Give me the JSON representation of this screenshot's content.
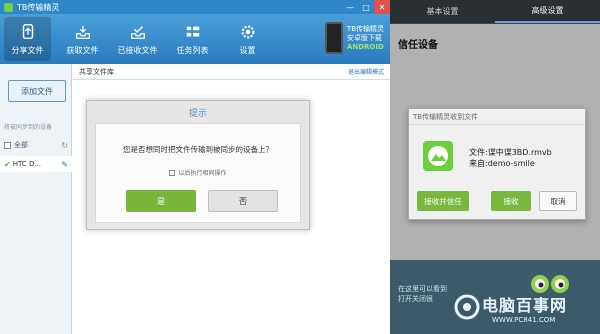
{
  "app": {
    "title": "TB传输精灵",
    "window_buttons": [
      "—",
      "□",
      "✕"
    ]
  },
  "toolbar": {
    "items": [
      {
        "label": "分享文件",
        "icon": "phone-share-icon"
      },
      {
        "label": "获取文件",
        "icon": "inbox-download-icon"
      },
      {
        "label": "已接收文件",
        "icon": "inbox-check-icon"
      },
      {
        "label": "任务列表",
        "icon": "task-list-icon"
      },
      {
        "label": "设置",
        "icon": "gear-icon"
      }
    ],
    "brand_line1": "TB传输精灵",
    "brand_line2": "安卓版下载",
    "brand_line3": "ANDROID"
  },
  "sidebar": {
    "add_button": "添加文件",
    "header": "将被同步到的设备",
    "all_label": "全部",
    "device_label": "HTC D..."
  },
  "main": {
    "header_title": "共享文件库",
    "exit_mode": "退出编辑模式"
  },
  "dialog": {
    "title": "提示",
    "message": "您是否想同时把文件传输到被同步的设备上？",
    "checkbox_label": "以后执行相同操作",
    "yes": "是",
    "no": "否"
  },
  "phone": {
    "tabs": [
      "基本设置",
      "高级设置"
    ],
    "heading": "信任设备",
    "receive_dialog": {
      "title": "TB传输精灵收到文件",
      "file_line": "文件:谍中谍3BD.rmvb",
      "from_line": "来自:demo-smile",
      "accept_trust": "接收并信任",
      "accept": "接收",
      "cancel": "取消"
    },
    "bottom_line1": "在这里可以看到",
    "bottom_line2": "打开关闭很"
  },
  "watermark": {
    "main": "电脑百事网",
    "url": "WWW.PC841.COM"
  },
  "colors": {
    "titlebar": "#2f86c8",
    "toolbar": "#3a8fd0",
    "accent_green": "#79b83f",
    "link_blue": "#2b78c4"
  }
}
